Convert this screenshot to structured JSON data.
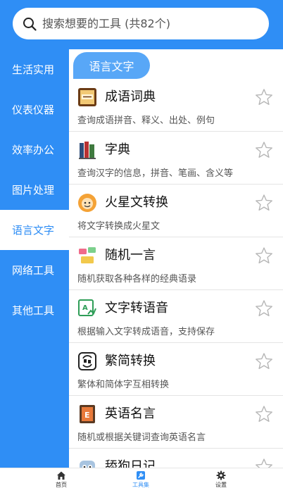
{
  "search": {
    "placeholder": "搜索想要的工具 (共82个)"
  },
  "sidebar": {
    "items": [
      {
        "label": "生活实用"
      },
      {
        "label": "仪表仪器"
      },
      {
        "label": "效率办公"
      },
      {
        "label": "图片处理"
      },
      {
        "label": "语言文字",
        "active": true
      },
      {
        "label": "网络工具"
      },
      {
        "label": "其他工具"
      }
    ]
  },
  "content": {
    "category_title": "语言文字",
    "tools": [
      {
        "name": "成语词典",
        "desc": "查询成语拼音、释义、出处、例句",
        "icon": "idiom-dictionary-icon"
      },
      {
        "name": "字典",
        "desc": "查询汉字的信息，拼音、笔画、含义等",
        "icon": "books-icon"
      },
      {
        "name": "火星文转换",
        "desc": "将文字转换成火星文",
        "icon": "martian-text-icon"
      },
      {
        "name": "随机一言",
        "desc": "随机获取各种各样的经典语录",
        "icon": "quote-cards-icon"
      },
      {
        "name": "文字转语音",
        "desc": "根据输入文字转成语音，支持保存",
        "icon": "text-to-speech-icon"
      },
      {
        "name": "繁简转换",
        "desc": "繁体和简体字互相转换",
        "icon": "traditional-simplified-icon"
      },
      {
        "name": "英语名言",
        "desc": "随机或根据关键词查询英语名言",
        "icon": "english-quote-icon"
      },
      {
        "name": "舔狗日记",
        "desc": "",
        "icon": "robot-icon"
      }
    ]
  },
  "tabbar": {
    "items": [
      {
        "label": "首页",
        "icon": "home-icon"
      },
      {
        "label": "工具集",
        "icon": "tools-icon",
        "active": true
      },
      {
        "label": "设置",
        "icon": "gear-icon"
      }
    ]
  },
  "colors": {
    "accent": "#2f8ef5",
    "tab_bg": "#58a7f7"
  }
}
